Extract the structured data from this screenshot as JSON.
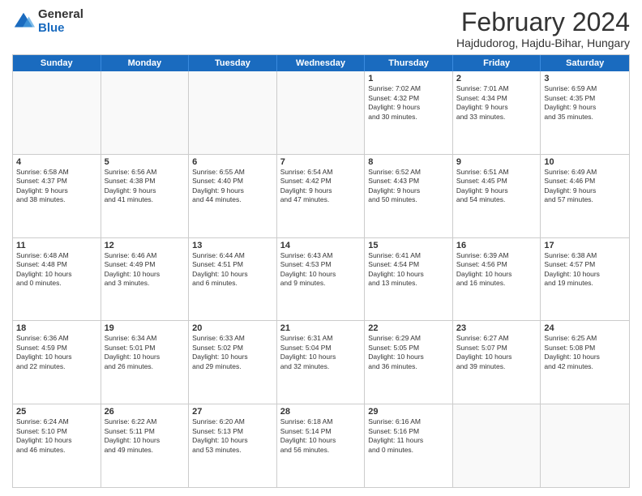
{
  "header": {
    "logo_general": "General",
    "logo_blue": "Blue",
    "title": "February 2024",
    "subtitle": "Hajdudorog, Hajdu-Bihar, Hungary"
  },
  "days_of_week": [
    "Sunday",
    "Monday",
    "Tuesday",
    "Wednesday",
    "Thursday",
    "Friday",
    "Saturday"
  ],
  "weeks": [
    [
      {
        "day": "",
        "info": ""
      },
      {
        "day": "",
        "info": ""
      },
      {
        "day": "",
        "info": ""
      },
      {
        "day": "",
        "info": ""
      },
      {
        "day": "1",
        "info": "Sunrise: 7:02 AM\nSunset: 4:32 PM\nDaylight: 9 hours\nand 30 minutes."
      },
      {
        "day": "2",
        "info": "Sunrise: 7:01 AM\nSunset: 4:34 PM\nDaylight: 9 hours\nand 33 minutes."
      },
      {
        "day": "3",
        "info": "Sunrise: 6:59 AM\nSunset: 4:35 PM\nDaylight: 9 hours\nand 35 minutes."
      }
    ],
    [
      {
        "day": "4",
        "info": "Sunrise: 6:58 AM\nSunset: 4:37 PM\nDaylight: 9 hours\nand 38 minutes."
      },
      {
        "day": "5",
        "info": "Sunrise: 6:56 AM\nSunset: 4:38 PM\nDaylight: 9 hours\nand 41 minutes."
      },
      {
        "day": "6",
        "info": "Sunrise: 6:55 AM\nSunset: 4:40 PM\nDaylight: 9 hours\nand 44 minutes."
      },
      {
        "day": "7",
        "info": "Sunrise: 6:54 AM\nSunset: 4:42 PM\nDaylight: 9 hours\nand 47 minutes."
      },
      {
        "day": "8",
        "info": "Sunrise: 6:52 AM\nSunset: 4:43 PM\nDaylight: 9 hours\nand 50 minutes."
      },
      {
        "day": "9",
        "info": "Sunrise: 6:51 AM\nSunset: 4:45 PM\nDaylight: 9 hours\nand 54 minutes."
      },
      {
        "day": "10",
        "info": "Sunrise: 6:49 AM\nSunset: 4:46 PM\nDaylight: 9 hours\nand 57 minutes."
      }
    ],
    [
      {
        "day": "11",
        "info": "Sunrise: 6:48 AM\nSunset: 4:48 PM\nDaylight: 10 hours\nand 0 minutes."
      },
      {
        "day": "12",
        "info": "Sunrise: 6:46 AM\nSunset: 4:49 PM\nDaylight: 10 hours\nand 3 minutes."
      },
      {
        "day": "13",
        "info": "Sunrise: 6:44 AM\nSunset: 4:51 PM\nDaylight: 10 hours\nand 6 minutes."
      },
      {
        "day": "14",
        "info": "Sunrise: 6:43 AM\nSunset: 4:53 PM\nDaylight: 10 hours\nand 9 minutes."
      },
      {
        "day": "15",
        "info": "Sunrise: 6:41 AM\nSunset: 4:54 PM\nDaylight: 10 hours\nand 13 minutes."
      },
      {
        "day": "16",
        "info": "Sunrise: 6:39 AM\nSunset: 4:56 PM\nDaylight: 10 hours\nand 16 minutes."
      },
      {
        "day": "17",
        "info": "Sunrise: 6:38 AM\nSunset: 4:57 PM\nDaylight: 10 hours\nand 19 minutes."
      }
    ],
    [
      {
        "day": "18",
        "info": "Sunrise: 6:36 AM\nSunset: 4:59 PM\nDaylight: 10 hours\nand 22 minutes."
      },
      {
        "day": "19",
        "info": "Sunrise: 6:34 AM\nSunset: 5:01 PM\nDaylight: 10 hours\nand 26 minutes."
      },
      {
        "day": "20",
        "info": "Sunrise: 6:33 AM\nSunset: 5:02 PM\nDaylight: 10 hours\nand 29 minutes."
      },
      {
        "day": "21",
        "info": "Sunrise: 6:31 AM\nSunset: 5:04 PM\nDaylight: 10 hours\nand 32 minutes."
      },
      {
        "day": "22",
        "info": "Sunrise: 6:29 AM\nSunset: 5:05 PM\nDaylight: 10 hours\nand 36 minutes."
      },
      {
        "day": "23",
        "info": "Sunrise: 6:27 AM\nSunset: 5:07 PM\nDaylight: 10 hours\nand 39 minutes."
      },
      {
        "day": "24",
        "info": "Sunrise: 6:25 AM\nSunset: 5:08 PM\nDaylight: 10 hours\nand 42 minutes."
      }
    ],
    [
      {
        "day": "25",
        "info": "Sunrise: 6:24 AM\nSunset: 5:10 PM\nDaylight: 10 hours\nand 46 minutes."
      },
      {
        "day": "26",
        "info": "Sunrise: 6:22 AM\nSunset: 5:11 PM\nDaylight: 10 hours\nand 49 minutes."
      },
      {
        "day": "27",
        "info": "Sunrise: 6:20 AM\nSunset: 5:13 PM\nDaylight: 10 hours\nand 53 minutes."
      },
      {
        "day": "28",
        "info": "Sunrise: 6:18 AM\nSunset: 5:14 PM\nDaylight: 10 hours\nand 56 minutes."
      },
      {
        "day": "29",
        "info": "Sunrise: 6:16 AM\nSunset: 5:16 PM\nDaylight: 11 hours\nand 0 minutes."
      },
      {
        "day": "",
        "info": ""
      },
      {
        "day": "",
        "info": ""
      }
    ]
  ]
}
